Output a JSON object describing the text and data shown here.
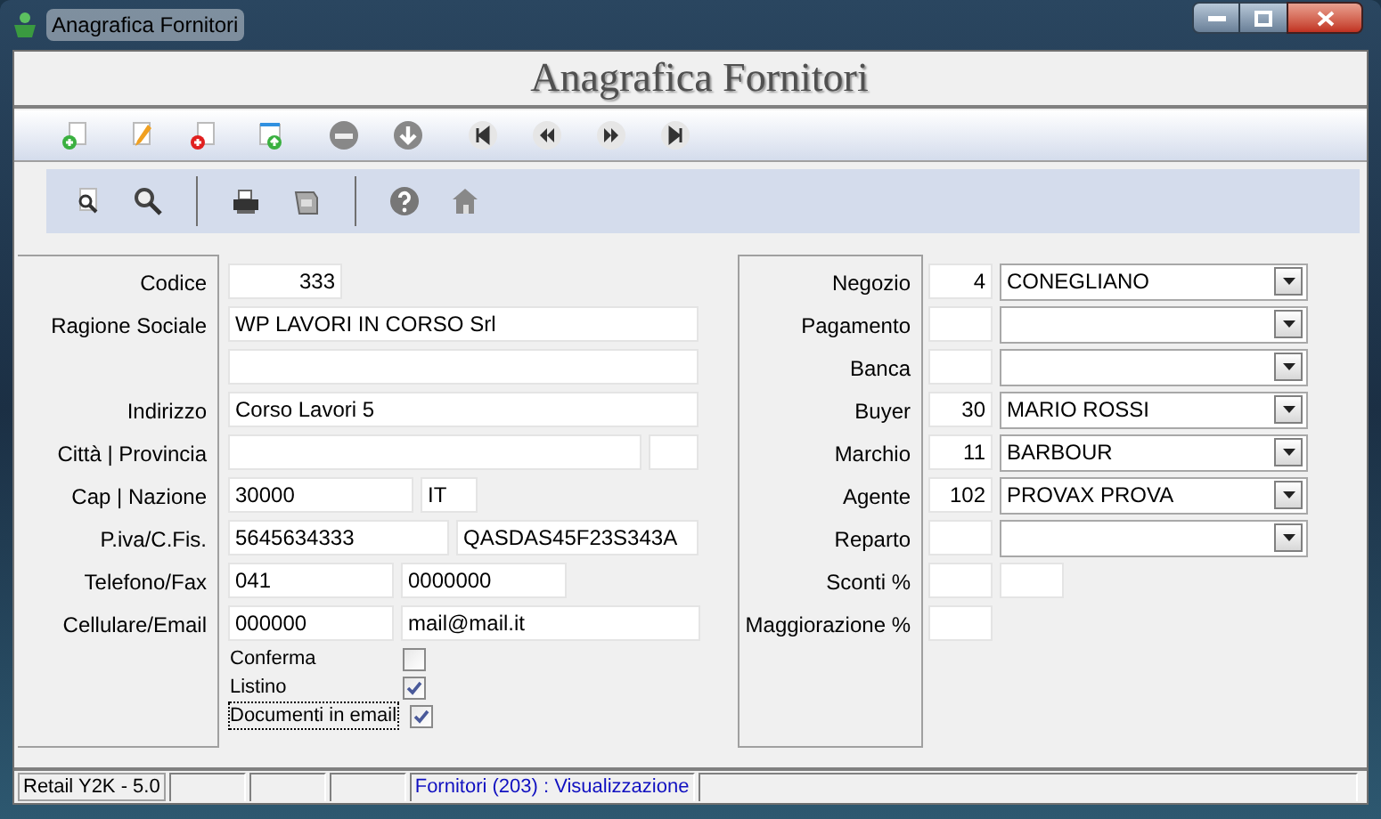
{
  "window": {
    "title": "Anagrafica Fornitori"
  },
  "header": {
    "title": "Anagrafica Fornitori"
  },
  "left_form": {
    "rows": [
      {
        "label": "Codice",
        "fields": [
          {
            "value": "333",
            "kind": "number"
          }
        ]
      },
      {
        "label": "Ragione Sociale",
        "fields": [
          {
            "value": "WP LAVORI IN CORSO Srl",
            "kind": "text"
          }
        ]
      },
      {
        "fields": [
          {
            "kind": "text"
          }
        ]
      },
      {
        "label": "Indirizzo",
        "fields": [
          {
            "value": "Corso Lavori 5",
            "kind": "text"
          }
        ]
      },
      {
        "label": "Città | Provincia",
        "fields": [
          {
            "kind": "text"
          },
          {
            "kind": "text"
          }
        ]
      },
      {
        "label": "Cap | Nazione",
        "fields": [
          {
            "value": "30000",
            "kind": "text"
          },
          {
            "value": "IT",
            "kind": "text"
          }
        ]
      },
      {
        "label": "P.iva/C.Fis.",
        "fields": [
          {
            "value": "5645634333",
            "kind": "text"
          },
          {
            "value": "QASDAS45F23S343A",
            "kind": "text"
          }
        ]
      },
      {
        "label": "Telefono/Fax",
        "fields": [
          {
            "value": "041",
            "kind": "text"
          },
          {
            "value": "0000000",
            "kind": "text"
          }
        ]
      },
      {
        "label": "Cellulare/Email",
        "fields": [
          {
            "value": "000000",
            "kind": "text"
          },
          {
            "value": "mail@mail.it",
            "kind": "text"
          }
        ]
      }
    ],
    "checkboxes": [
      {
        "label": "Conferma",
        "checked": false,
        "focused": false
      },
      {
        "label": "Listino",
        "checked": true,
        "focused": false
      },
      {
        "label": "Documenti in email",
        "checked": true,
        "focused": true
      }
    ]
  },
  "right_form": {
    "rows": [
      {
        "label": "Negozio",
        "kind": "combo",
        "code": "4",
        "value": "CONEGLIANO"
      },
      {
        "label": "Pagamento",
        "kind": "combo"
      },
      {
        "label": "Banca",
        "kind": "combo"
      },
      {
        "label": "Buyer",
        "kind": "combo",
        "code": "30",
        "value": "MARIO ROSSI"
      },
      {
        "label": "Marchio",
        "kind": "combo",
        "code": "11",
        "value": "BARBOUR"
      },
      {
        "label": "Agente",
        "kind": "combo",
        "code": "102",
        "value": "PROVAX PROVA"
      },
      {
        "label": "Reparto",
        "kind": "combo"
      },
      {
        "label": "Sconti %",
        "kind": "pair"
      },
      {
        "label": "Maggiorazione %",
        "kind": "single"
      }
    ]
  },
  "status_bar": [
    {
      "kind": "label",
      "text": "Retail Y2K - 5.0"
    },
    {
      "kind": "empty"
    },
    {
      "kind": "empty"
    },
    {
      "kind": "empty"
    },
    {
      "kind": "status",
      "text": "Fornitori (203) : Visualizzazione"
    },
    {
      "kind": "empty"
    }
  ]
}
